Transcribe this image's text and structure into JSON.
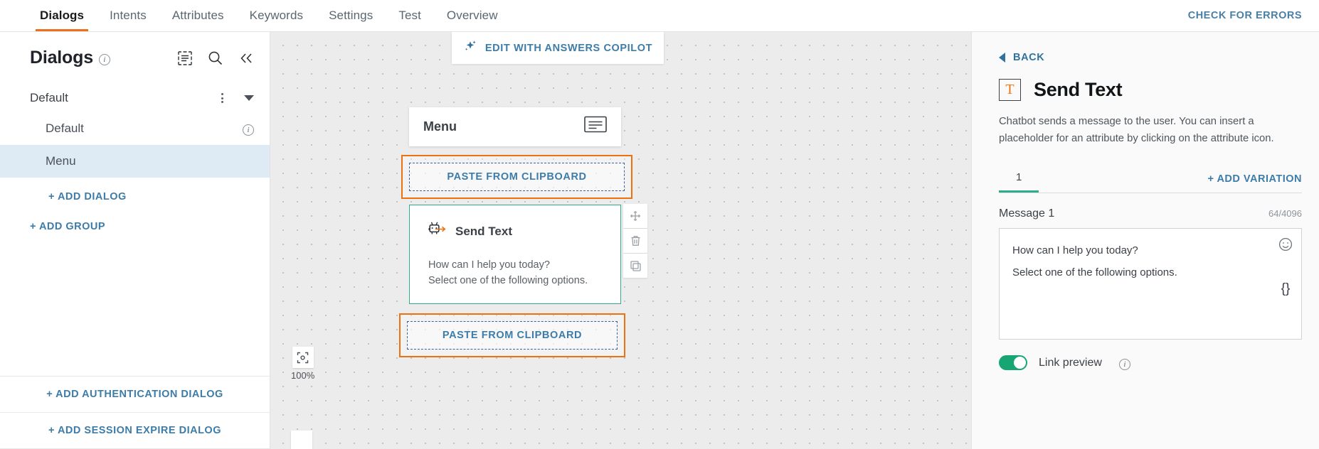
{
  "topbar": {
    "tabs": [
      {
        "label": "Dialogs",
        "active": true
      },
      {
        "label": "Intents",
        "active": false
      },
      {
        "label": "Attributes",
        "active": false
      },
      {
        "label": "Keywords",
        "active": false
      },
      {
        "label": "Settings",
        "active": false
      },
      {
        "label": "Test",
        "active": false
      },
      {
        "label": "Overview",
        "active": false
      }
    ],
    "check_errors_label": "CHECK FOR ERRORS",
    "accent_color": "#e8721c",
    "link_color": "#3d7ca8"
  },
  "sidebar": {
    "title": "Dialogs",
    "icons": {
      "info": "info-icon",
      "list": "list-select-icon",
      "search": "search-icon",
      "collapse": "collapse-left-icon"
    },
    "group": {
      "label": "Default",
      "menu_icon": "kebab-menu-icon",
      "expand_icon": "chevron-down-icon"
    },
    "dialogs": [
      {
        "label": "Default",
        "selected": false,
        "has_info": true
      },
      {
        "label": "Menu",
        "selected": true,
        "has_info": false
      }
    ],
    "add_dialog_label": "+ ADD DIALOG",
    "add_group_label": "+ ADD GROUP",
    "footer": [
      {
        "label": "+ ADD AUTHENTICATION DIALOG"
      },
      {
        "label": "+ ADD SESSION EXPIRE DIALOG"
      }
    ],
    "selected_bg": "#deebf5"
  },
  "canvas": {
    "copilot_label": "EDIT WITH ANSWERS COPILOT",
    "copilot_icon": "sparkle-icon",
    "menu_node": {
      "title": "Menu",
      "icon": "chat-bubble-icon"
    },
    "paste_top_label": "PASTE FROM CLIPBOARD",
    "paste_bottom_label": "PASTE FROM CLIPBOARD",
    "paste_border_color": "#ec7211",
    "send_text_node": {
      "title": "Send Text",
      "icon": "robot-send-icon",
      "line1": "How can I help you today?",
      "line2": "Select one of the following options.",
      "border_color": "#2fab8e"
    },
    "tools": [
      {
        "icon": "move-icon"
      },
      {
        "icon": "trash-icon"
      },
      {
        "icon": "copy-icon"
      }
    ],
    "zoom_level": "100%",
    "zoom_fit_icon": "fit-to-screen-icon"
  },
  "panel": {
    "back_label": "BACK",
    "back_icon": "back-triangle-icon",
    "title": "Send Text",
    "title_icon": "text-box-icon",
    "description": "Chatbot sends a message to the user. You can insert a placeholder for an attribute by clicking on the attribute icon.",
    "variation_tab": "1",
    "add_variation_label": "+ ADD VARIATION",
    "message_label": "Message 1",
    "message_counter": "64/4096",
    "message_line1": "How can I help you today?",
    "message_line2": "Select one of the following options.",
    "emoji_icon": "emoji-smiley-icon",
    "attribute_icon": "curly-braces-icon",
    "link_preview_label": "Link preview",
    "link_preview_info_icon": "info-icon",
    "link_preview_on": true,
    "toggle_color": "#17a673",
    "tab_underline_color": "#2fab8e"
  }
}
